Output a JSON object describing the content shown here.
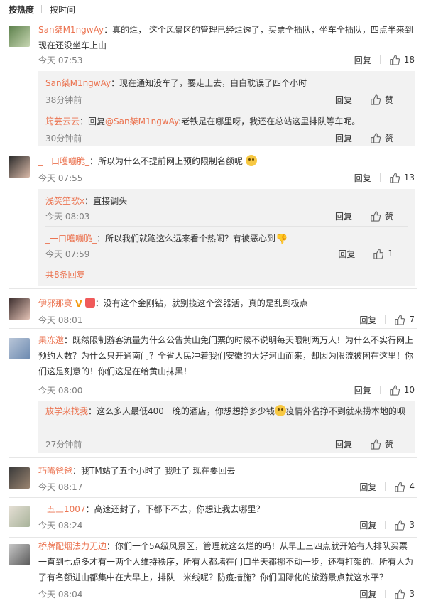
{
  "sort": {
    "hot": "按热度",
    "time": "按时间"
  },
  "reply_label": "回复",
  "like_label": "赞",
  "comments": [
    {
      "user": "San桀M1ngwAy",
      "text": "：真的烂， 这个风景区的管理已经烂透了，买票全插队，坐车全插队，四点半来到现在还没坐车上山",
      "time": "今天 07:53",
      "likes": "18",
      "replies": [
        {
          "user": "San桀M1ngwAy",
          "text": "：现在通知没车了，要走上去，白白耽误了四个小时",
          "time": "38分钟前",
          "likes": "赞"
        },
        {
          "user": "筠芸云云",
          "pre": "：回复",
          "mention": "@San桀M1ngwAy",
          "text": ":老铁是在哪里呀，我还在总站这里排队等车呢。",
          "time": "30分钟前",
          "likes": "赞"
        }
      ]
    },
    {
      "user": "_一口嚄嘣脆_",
      "text": "：所以为什么不提前网上预约限制名额呢",
      "time": "今天 07:55",
      "likes": "13",
      "replies": [
        {
          "user": "浅笑笙歌x",
          "text": "：直接调头",
          "time": "今天 08:03",
          "likes": "赞"
        },
        {
          "user": "_一口嚄嘣脆_",
          "text": "：所以我们就跑这么远来看个热闹？有被恶心到",
          "time": "今天 07:59",
          "likes": "1"
        }
      ],
      "more": "共8条回复"
    },
    {
      "user": "伊邪那寞",
      "text": "：没有这个金刚钻，就别揽这个瓷器活，真的是乱到极点",
      "time": "今天 08:01",
      "likes": "7"
    },
    {
      "user": "果冻逖",
      "text": "：既然限制游客流量为什么公告黄山免门票的时候不说明每天限制两万人！为什么不实行网上预约人数？为什么只开通南门？全省人民冲着我们安徽的大好河山而来，却因为限流被困在这里！你们这是刻意的！你们这是在给黄山抹黑！",
      "time": "今天 08:00",
      "likes": "10",
      "replies": [
        {
          "user": "放学来找我",
          "text": "：这么多人最低400一晚的酒店，你想想挣多少钱",
          "text2": "疫情外省挣不到就来捞本地的呗",
          "time": "27分钟前",
          "likes": "赞"
        }
      ]
    },
    {
      "user": "巧嘴爸爸",
      "text": "：我TM站了五个小时了 我吐了 现在要回去",
      "time": "今天 08:17",
      "likes": "4"
    },
    {
      "user": "一五三1007",
      "text": "：高速还封了，下都下不去，你想让我去哪里？",
      "time": "今天 08:24",
      "likes": "3"
    },
    {
      "user": "桥牌配烟法力无边",
      "text": "：你们一个5A级风景区，管理就这么烂的吗！从早上三四点就开始有人排队买票一直到七点多才有一两个人维持秩序，所有人都堵在门口半天都挪不动一步，还有打架的。所有人为了有名额进山都集中在大早上，排队一米线呢？防疫措施？你们国际化的旅游景点就这水平？",
      "time": "今天 08:04",
      "likes": "3"
    }
  ]
}
